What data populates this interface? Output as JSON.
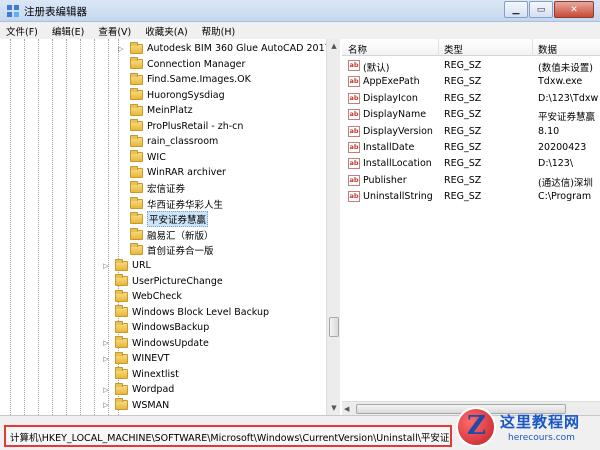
{
  "window": {
    "title": "注册表编辑器",
    "minimize_label": "▁",
    "restore_label": "▭",
    "close_label": "✕"
  },
  "menu": [
    {
      "label": "文件(F)"
    },
    {
      "label": "编辑(E)"
    },
    {
      "label": "查看(V)"
    },
    {
      "label": "收藏夹(A)"
    },
    {
      "label": "帮助(H)"
    }
  ],
  "tree": {
    "children_items": [
      {
        "label": "Autodesk BIM 360 Glue AutoCAD 2017 A",
        "expandable": true
      },
      {
        "label": "Connection Manager",
        "expandable": false
      },
      {
        "label": "Find.Same.Images.OK",
        "expandable": false
      },
      {
        "label": "HuorongSysdiag",
        "expandable": false
      },
      {
        "label": "MeinPlatz",
        "expandable": false
      },
      {
        "label": "ProPlusRetail - zh-cn",
        "expandable": false
      },
      {
        "label": "rain_classroom",
        "expandable": false
      },
      {
        "label": "WIC",
        "expandable": false
      },
      {
        "label": "WinRAR archiver",
        "expandable": false
      },
      {
        "label": "宏信证券",
        "expandable": false
      },
      {
        "label": "华西证券华彩人生",
        "expandable": false
      },
      {
        "label": "平安证券慧赢",
        "expandable": false,
        "selected": true
      },
      {
        "label": "融易汇（新版）",
        "expandable": false
      },
      {
        "label": "首创证券合一版",
        "expandable": false
      }
    ],
    "sibling_items": [
      {
        "label": "URL",
        "expandable": true
      },
      {
        "label": "UserPictureChange",
        "expandable": false
      },
      {
        "label": "WebCheck",
        "expandable": false
      },
      {
        "label": "Windows Block Level Backup",
        "expandable": false
      },
      {
        "label": "WindowsBackup",
        "expandable": false
      },
      {
        "label": "WindowsUpdate",
        "expandable": true
      },
      {
        "label": "WINEVT",
        "expandable": true
      },
      {
        "label": "Winextlist",
        "expandable": false
      },
      {
        "label": "Wordpad",
        "expandable": true
      },
      {
        "label": "WSMAN",
        "expandable": true
      }
    ]
  },
  "values": {
    "columns": {
      "name": "名称",
      "type": "类型",
      "data": "数据"
    },
    "rows": [
      {
        "name": "(默认)",
        "type": "REG_SZ",
        "data": "(数值未设置)"
      },
      {
        "name": "AppExePath",
        "type": "REG_SZ",
        "data": "Tdxw.exe"
      },
      {
        "name": "DisplayIcon",
        "type": "REG_SZ",
        "data": "D:\\123\\Tdxw"
      },
      {
        "name": "DisplayName",
        "type": "REG_SZ",
        "data": "平安证券慧赢"
      },
      {
        "name": "DisplayVersion",
        "type": "REG_SZ",
        "data": "8.10"
      },
      {
        "name": "InstallDate",
        "type": "REG_SZ",
        "data": "20200423"
      },
      {
        "name": "InstallLocation",
        "type": "REG_SZ",
        "data": "D:\\123\\"
      },
      {
        "name": "Publisher",
        "type": "REG_SZ",
        "data": "(通达信)深圳"
      },
      {
        "name": "UninstallString",
        "type": "REG_SZ",
        "data": "C:\\Program"
      }
    ]
  },
  "status": {
    "path": "计算机\\HKEY_LOCAL_MACHINE\\SOFTWARE\\Microsoft\\Windows\\CurrentVersion\\Uninstall\\平安证券慧赢"
  },
  "watermark": {
    "letter": "Z",
    "cn_text": "这里教程网",
    "en_text": "herecours.com"
  },
  "colors": {
    "highlight_border": "#e53935",
    "selection": "#cce4f7"
  }
}
